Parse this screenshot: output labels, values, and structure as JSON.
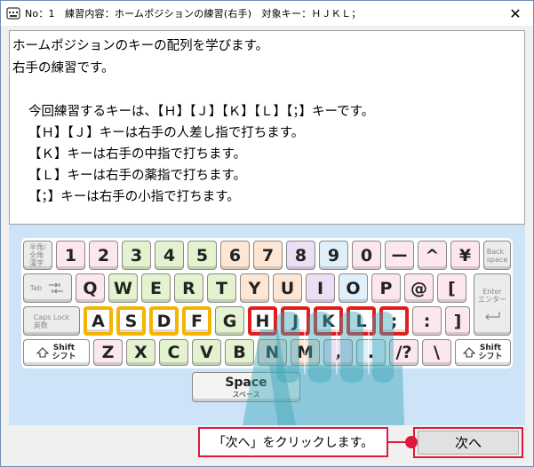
{
  "window": {
    "title": "No：1　練習内容：ホームポジションの練習(右手)　対象キー：ＨＪＫＬ；",
    "close_glyph": "✕"
  },
  "instructions": {
    "line1": "ホームポジションのキーの配列を学びます。",
    "line2": "右手の練習です。",
    "line3": "今回練習するキーは、【Ｈ】【Ｊ】【Ｋ】【Ｌ】【；】キーです。",
    "line4": "【Ｈ】【Ｊ】キーは右手の人差し指で打ちます。",
    "line5": "【Ｋ】キーは右手の中指で打ちます。",
    "line6": "【Ｌ】キーは右手の薬指で打ちます。",
    "line7": "【；】キーは右手の小指で打ちます。"
  },
  "keyboard": {
    "colors": {
      "gray": "#ececec",
      "pink": "#fde7ee",
      "green": "#e3f2cf",
      "blue": "#dff0fa",
      "peach": "#fde6d4",
      "lilac": "#ecdff3",
      "orange_border": "#f5b400",
      "red_border": "#e01e1e"
    },
    "row1": {
      "hankaku": "半角/\n全角\n漢字",
      "k1": "1",
      "k2": "2",
      "k3": "3",
      "k4": "4",
      "k5": "5",
      "k6": "6",
      "k7": "7",
      "k8": "8",
      "k9": "9",
      "k0": "0",
      "minus": "ー",
      "caret": "^",
      "yen": "¥",
      "backspace": "Back\nspace"
    },
    "row2": {
      "tab": "Tab",
      "q": "Q",
      "w": "W",
      "e": "E",
      "r": "R",
      "t": "T",
      "y": "Y",
      "u": "U",
      "i": "I",
      "o": "O",
      "p": "P",
      "at": "@",
      "bracket": "[",
      "enter": "Enter\nエンター"
    },
    "row3": {
      "caps": "Caps Lock\n英数",
      "a": "A",
      "s": "S",
      "d": "D",
      "f": "F",
      "g": "G",
      "h": "H",
      "j": "J",
      "k": "K",
      "l": "L",
      "semicolon": ";",
      "colon": ":",
      "rbracket": "]"
    },
    "row4": {
      "lshift": "Shift\nシフト",
      "z": "Z",
      "x": "X",
      "c": "C",
      "v": "V",
      "b": "B",
      "n": "N",
      "m": "M",
      "comma": ",",
      "period": ".",
      "slash": "/?",
      "backslash": "\\",
      "rshift": "Shift\nシフト"
    },
    "space": {
      "label": "Space",
      "sub": "スペース"
    }
  },
  "footer": {
    "callout_text": "「次へ」をクリックします。",
    "next_button_label": "次へ",
    "accent": "#e0183c"
  }
}
